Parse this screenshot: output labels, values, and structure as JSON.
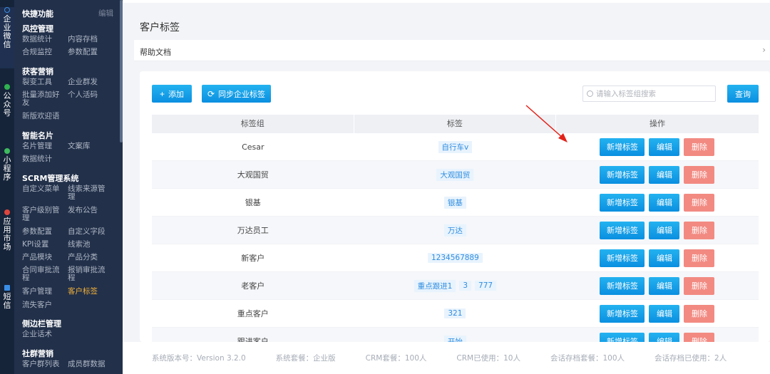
{
  "rail": [
    {
      "label": "企业微信",
      "icon": "search-icon",
      "color": "#3a8ee6",
      "active": true
    },
    {
      "label": "公众号",
      "icon": "wechat-icon",
      "color": "#2fb24f"
    },
    {
      "label": "小程序",
      "icon": "miniapp-icon",
      "color": "#3dbb5e"
    },
    {
      "label": "应用市场",
      "icon": "appstore-icon",
      "color": "#e0453c"
    },
    {
      "label": "短信",
      "icon": "mail-icon",
      "color": "#3a8ee6"
    }
  ],
  "sidebar": {
    "quick": "快捷功能",
    "edit": "编辑",
    "sections": [
      {
        "title": "风控管理",
        "items": [
          "数据统计",
          "内容存档",
          "合规监控",
          "参数配置"
        ]
      },
      {
        "title": "获客营销",
        "items": [
          "裂变工具",
          "企业群发",
          "批量添加好友",
          "个人活码",
          "新版欢迎语"
        ]
      },
      {
        "title": "智能名片",
        "items": [
          "名片管理",
          "文案库",
          "数据统计"
        ]
      },
      {
        "title": "SCRM管理系统",
        "items": [
          "自定义菜单",
          "线索来源管理",
          "客户级别管理",
          "发布公告",
          "参数配置",
          "自定义字段",
          "KPI设置",
          "线索池",
          "产品模块",
          "产品分类",
          "合同审批流程",
          "报销审批流程",
          "客户管理",
          "客户标签",
          "流失客户"
        ]
      },
      {
        "title": "侧边栏管理",
        "items": [
          "企业话术"
        ]
      },
      {
        "title": "社群营销",
        "items": [
          "客户群列表",
          "成员群数据"
        ]
      }
    ]
  },
  "page": {
    "title": "客户标签",
    "help": "帮助文档",
    "add_btn": "添加",
    "sync_btn": "同步企业标签",
    "search_placeholder": "请输入标签组搜索",
    "query_btn": "查询"
  },
  "table": {
    "headers": [
      "标签组",
      "标签",
      "操作"
    ],
    "op_add": "新增标签",
    "op_edit": "编辑",
    "op_delete": "删除",
    "rows": [
      {
        "group": "Cesar",
        "tags": [
          "自行车v"
        ]
      },
      {
        "group": "大观国贸",
        "tags": [
          "大观国贸"
        ]
      },
      {
        "group": "银基",
        "tags": [
          "银基"
        ]
      },
      {
        "group": "万达员工",
        "tags": [
          "万达"
        ]
      },
      {
        "group": "新客户",
        "tags": [
          "1234567889"
        ]
      },
      {
        "group": "老客户",
        "tags": [
          "重点跟进1",
          "3",
          "777"
        ]
      },
      {
        "group": "重点客户",
        "tags": [
          "321"
        ]
      },
      {
        "group": "跟进客户",
        "tags": [
          "开始"
        ]
      }
    ]
  },
  "footer": [
    "系统版本号：Version 3.2.0",
    "系统套餐：企业版",
    "CRM套餐：100人",
    "CRM已使用：10人",
    "会话存档套餐：100人",
    "会话存档已使用：2人"
  ]
}
